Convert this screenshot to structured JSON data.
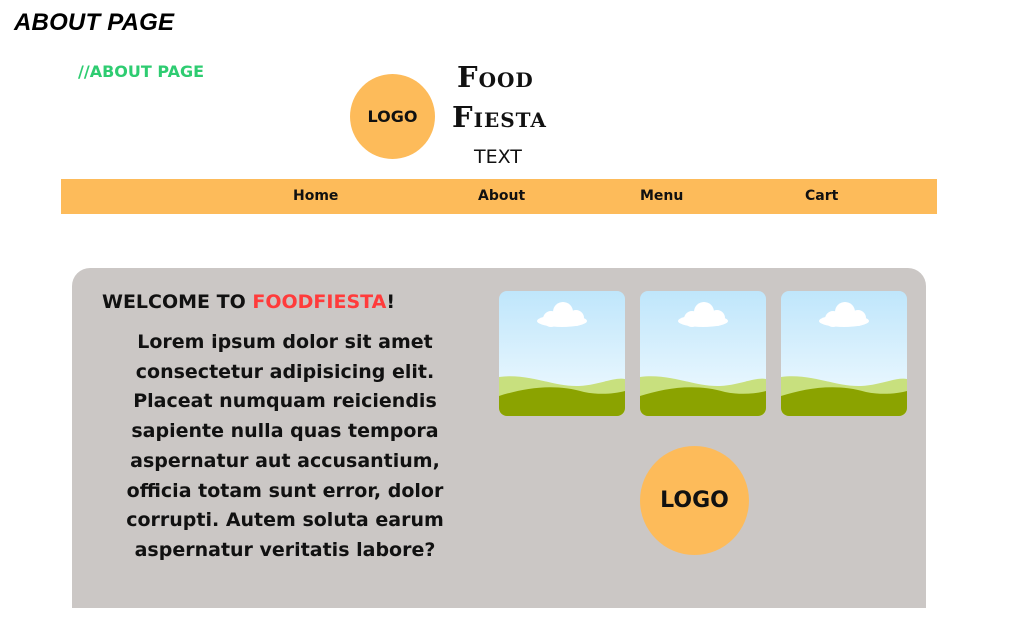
{
  "page_heading": "ABOUT PAGE",
  "comment_label": "//ABOUT PAGE",
  "header": {
    "logo_text": "LOGO",
    "brand_line1": "Food",
    "brand_line2": "Fiesta",
    "brand_subtext": "TEXT"
  },
  "nav": {
    "items": [
      {
        "label": "Home"
      },
      {
        "label": "About"
      },
      {
        "label": "Menu"
      },
      {
        "label": "Cart"
      }
    ]
  },
  "main": {
    "welcome_prefix": "WELCOME  TO ",
    "welcome_brand": "FOODFIESTA",
    "welcome_suffix": "!",
    "body_text": "Lorem ipsum dolor sit amet consectetur adipisicing elit. Placeat numquam reiciendis sapiente nulla quas tempora aspernatur aut accusantium, officia totam sunt error, dolor corrupti. Autem soluta earum aspernatur veritatis labore?",
    "thumbnail_icons": [
      "landscape-image-icon",
      "landscape-image-icon",
      "landscape-image-icon"
    ],
    "logo_text": "LOGO"
  },
  "colors": {
    "accent": "#fdbb5a",
    "panel": "#cbc7c5",
    "comment": "#2ecc71",
    "brand_highlight": "#ff3b3b"
  }
}
